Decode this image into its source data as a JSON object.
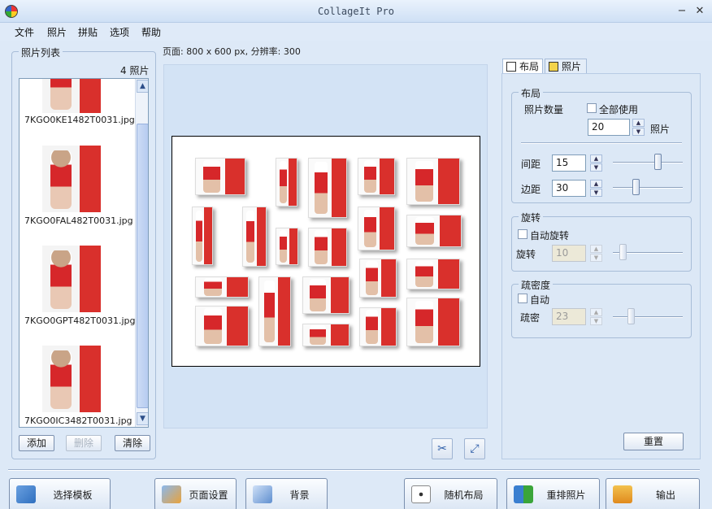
{
  "window": {
    "title": "CollageIt Pro",
    "minimize": "−",
    "close": "✕"
  },
  "menu": [
    "文件",
    "照片",
    "拼贴",
    "选项",
    "帮助"
  ],
  "photo_list": {
    "legend": "照片列表",
    "count_label": "4 照片",
    "items": [
      "7KGO0KE1482T0031.jpg",
      "7KGO0FAL482T0031.jpg",
      "7KGO0GPT482T0031.jpg",
      "7KGO0IC3482T0031.jpg"
    ],
    "add": "添加",
    "delete": "删除",
    "clear": "清除"
  },
  "page_info": "页面: 800 x 600 px, 分辨率: 300",
  "tabs": {
    "layout": "布局",
    "photo": "照片"
  },
  "layout_group": {
    "legend": "布局",
    "photo_count_label": "照片数量",
    "use_all_label": "全部使用",
    "photo_count_value": "20",
    "photo_unit": "照片",
    "spacing_label": "间距",
    "spacing_value": "15",
    "margin_label": "边距",
    "margin_value": "30"
  },
  "rotation_group": {
    "legend": "旋转",
    "auto_label": "自动旋转",
    "rotation_label": "旋转",
    "rotation_value": "10"
  },
  "density_group": {
    "legend": "疏密度",
    "auto_label": "自动",
    "density_label": "疏密",
    "density_value": "23"
  },
  "reset_label": "重置",
  "bottom_buttons": {
    "template": "选择模板",
    "page_setup": "页面设置",
    "background": "背景",
    "random_layout": "随机布局",
    "rearrange": "重排照片",
    "export": "输出"
  },
  "icons": {
    "app": "app-icon",
    "scroll_up": "▲",
    "scroll_down": "▼",
    "crop": "✂",
    "fit": "⤢"
  }
}
